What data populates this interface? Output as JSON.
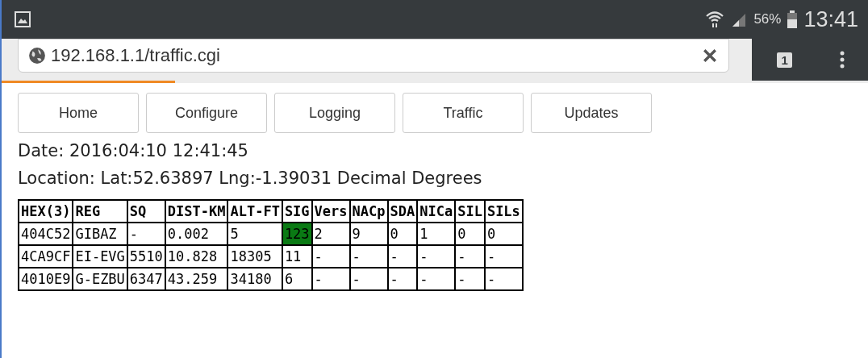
{
  "status_bar": {
    "battery": "56%",
    "time": "13:41"
  },
  "browser": {
    "url": "192.168.1.1/traffic.cgi",
    "tab_count": "1",
    "progress": {
      "level": 0.2
    }
  },
  "nav": [
    {
      "label": "Home"
    },
    {
      "label": "Configure"
    },
    {
      "label": "Logging"
    },
    {
      "label": "Traffic"
    },
    {
      "label": "Updates"
    }
  ],
  "date": "Date: 2016:04:10 12:41:45",
  "location": "Location: Lat:52.63897 Lng:-1.39031 Decimal Degrees",
  "table": {
    "columns": [
      "HEX(3)",
      "REG",
      "SQ",
      "DIST-KM",
      "ALT-FT",
      "SIG",
      "Vers",
      "NACp",
      "SDA",
      "NICa",
      "SIL",
      "SILs"
    ],
    "rows": [
      {
        "cells": [
          "404C52",
          "GIBAZ",
          "-",
          "0.002",
          "5",
          "123",
          "2",
          "9",
          "0",
          "1",
          "0",
          "0"
        ],
        "sig_highlight": true
      },
      {
        "cells": [
          "4CA9CF",
          "EI-EVG",
          "5510",
          "10.828",
          "18305",
          "11",
          "-",
          "-",
          "-",
          "-",
          "-",
          "-"
        ],
        "sig_highlight": false
      },
      {
        "cells": [
          "4010E9",
          "G-EZBU",
          "6347",
          "43.259",
          "34180",
          "6",
          "-",
          "-",
          "-",
          "-",
          "-",
          "-"
        ],
        "sig_highlight": false
      }
    ]
  }
}
